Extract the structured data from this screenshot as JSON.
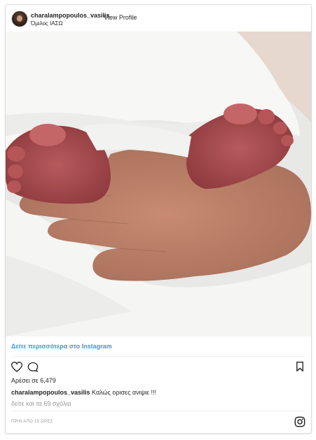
{
  "post": {
    "username": "charalampopoulos_vasilis",
    "location": "Όμιλος ΙΑΣΩ",
    "view_profile": "View Profile",
    "more_link": "Δείτε περισσότερα στο Instagram",
    "likes": "Αρέσει σε 6,479",
    "caption_user": "charalampopoulos_vasilis",
    "caption_text": " Καλώς ορισες ανιψιε !!!",
    "comments_link": "δείτε και τα 69 σχόλια",
    "time": "ΠΡΙΝ ΑΠΟ 15 ΩΡΕΣ"
  },
  "icons": {
    "like": "heart-icon",
    "comment": "comment-icon",
    "save": "bookmark-icon",
    "brand": "instagram-icon"
  },
  "colors": {
    "link": "#3897f0",
    "text": "#262626",
    "muted": "#999999"
  }
}
